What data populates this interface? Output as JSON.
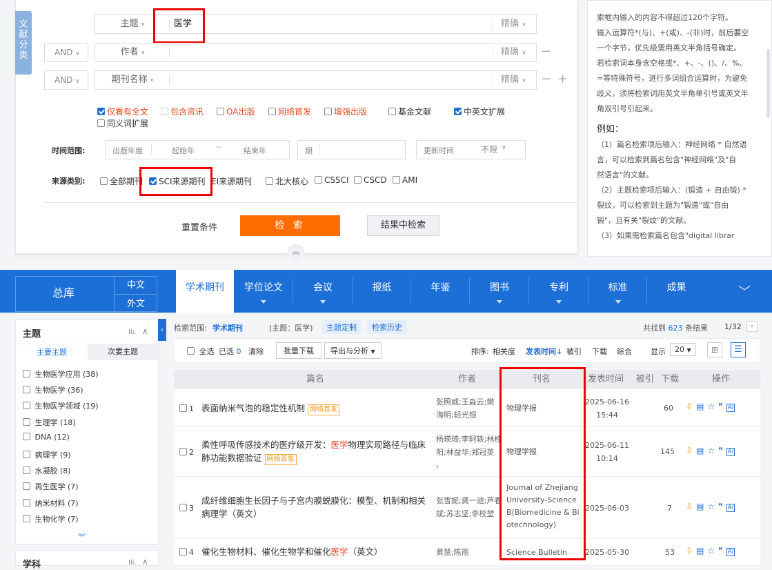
{
  "side_tab": [
    "文",
    "献",
    "分",
    "类"
  ],
  "fields": [
    {
      "logic": "",
      "label": "主题",
      "value": "医学",
      "mode": "精确"
    },
    {
      "logic": "AND",
      "label": "作者",
      "value": "",
      "mode": "精确"
    },
    {
      "logic": "AND",
      "label": "期刊名称",
      "value": "",
      "mode": "精确"
    }
  ],
  "options": [
    {
      "label": "仅看有全文",
      "checked": true,
      "red": true
    },
    {
      "label": "包含资讯",
      "checked": false,
      "red": true
    },
    {
      "label": "OA出版",
      "checked": false,
      "red": true
    },
    {
      "label": "网络首发",
      "checked": false,
      "red": true
    },
    {
      "label": "增强出版",
      "checked": false,
      "red": true
    },
    {
      "label": "基金文献",
      "checked": false,
      "red": false
    },
    {
      "label": "中英文扩展",
      "checked": true,
      "red": false
    },
    {
      "label": "同义词扩展",
      "checked": false,
      "red": false
    }
  ],
  "time": {
    "label": "时间范围:",
    "pub_year": "出版年度",
    "start": "起始年",
    "dash": "--",
    "end": "结束年",
    "issue": "期",
    "update": "更新时间",
    "unlimited": "不限"
  },
  "source": {
    "label": "来源类别:",
    "items": [
      {
        "label": "全部期刊",
        "checked": false
      },
      {
        "label": "SCI来源期刊",
        "checked": true
      },
      {
        "label": "EI来源期刊",
        "checked": false
      },
      {
        "label": "北大核心",
        "checked": false
      },
      {
        "label": "CSSCI",
        "checked": false
      },
      {
        "label": "CSCD",
        "checked": false
      },
      {
        "label": "AMI",
        "checked": false
      }
    ]
  },
  "buttons": {
    "reset": "重置条件",
    "search": "检 索",
    "in_result": "结果中检索"
  },
  "help": [
    "索框内输入的内容不得超过120个字符。",
    "输入运算符*(与)、+(或)、-(非)时，前后要空",
    "一个字节，优先级需用英文半角括号确定。",
    "若检索词本身含空格或*、+、-、()、/、%、",
    "=等特殊符号，进行多词组合运算时，为避免",
    "歧义，须将检索词用英文半角单引号或英文半",
    "角双引号引起来。",
    "例如：",
    "（1）篇名检索项后输入：神经网络 * 自然语",
    "言，可以检索到篇名包含\"神经网络\"及\"自",
    "然语言\"的文献。",
    "（2）主题检索项后输入：(锻造 + 自由锻) *",
    "裂纹，可以检索到主题为\"锻造\"或\"自由",
    "锻\"，且有关\"裂纹\"的文献。",
    "（3）如果需检索篇名包含\"digital librar"
  ],
  "nav": {
    "zongku": "总库",
    "zh": "中文",
    "en": "外文",
    "tabs": [
      "学术期刊",
      "学位论文",
      "会议",
      "报纸",
      "年鉴",
      "图书",
      "专利",
      "标准",
      "成果"
    ]
  },
  "facet": {
    "title": "主题",
    "tab1": "主要主题",
    "tab2": "次要主题",
    "items": [
      "生物医学应用 (38)",
      "生物医学 (36)",
      "生物医学领域 (19)",
      "生理学 (18)",
      "DNA (12)",
      "病理学 (9)",
      "水凝胶 (8)",
      "再生医学 (7)",
      "纳米材料 (7)",
      "生物化学 (7)"
    ],
    "next": "学科"
  },
  "results_bar": {
    "scope_label": "检索范围:",
    "scope": "学术期刊",
    "query": "(主题：医学)",
    "custom": "主题定制",
    "history": "检索历史",
    "found_pre": "共找到",
    "count": "623",
    "found_post": "条结果",
    "page": "1/32"
  },
  "toolbar": {
    "select_all": "全选",
    "selected": "已选",
    "selected_n": "0",
    "clear": "清除",
    "batch": "批量下载",
    "export": "导出与分析",
    "sort": "排序:",
    "relevance": "相关度",
    "pubtime": "发表时间",
    "cite": "被引",
    "download": "下载",
    "comprehensive": "综合",
    "show": "显示",
    "per_page": "20"
  },
  "headers": {
    "title": "篇名",
    "author": "作者",
    "journal": "刊名",
    "date": "发表时间",
    "cite": "被引",
    "dl": "下载",
    "ops": "操作"
  },
  "rows": [
    {
      "n": "1",
      "title": [
        "表面纳米气泡的稳定性机制"
      ],
      "tag": "网络首发",
      "author": "张照威;王淼云;樊海明;轻光银",
      "journal": "物理学报",
      "date": "2025-06-16",
      "time": "15:44",
      "cite": "",
      "dl": "60"
    },
    {
      "n": "2",
      "title": [
        "柔性呼吸传感技术的医疗级开发：",
        "医学",
        "物理实现路径与临床肺功能数据验证"
      ],
      "tag": "网络首发",
      "author": "杨瑛琦;李轲轶;林桂阳;林益华;郑冠英",
      "journal": "物理学报",
      "date": "2025-06-11",
      "time": "10:14",
      "cite": "",
      "dl": "145"
    },
    {
      "n": "3",
      "title": [
        "成纤维细胞生长因子与子宫内膜蜕膜化：模型、机制和相关病理学（英文）"
      ],
      "tag": "",
      "author": "张雪妮;龚一迪;芦春斌;苏志坚;李校堃",
      "journal": "Journal of Zhejiang University-Science B(Biomedicine & Biotechnology)",
      "date": "2025-06-03",
      "time": "",
      "cite": "",
      "dl": "7"
    },
    {
      "n": "4",
      "title": [
        "催化生物材料、催化生物学和催化",
        "医学",
        "（英文）"
      ],
      "tag": "",
      "author": "黄慧;陈雨",
      "journal": "Science Bulletin",
      "date": "2025-05-30",
      "time": "",
      "cite": "",
      "dl": "53"
    }
  ]
}
